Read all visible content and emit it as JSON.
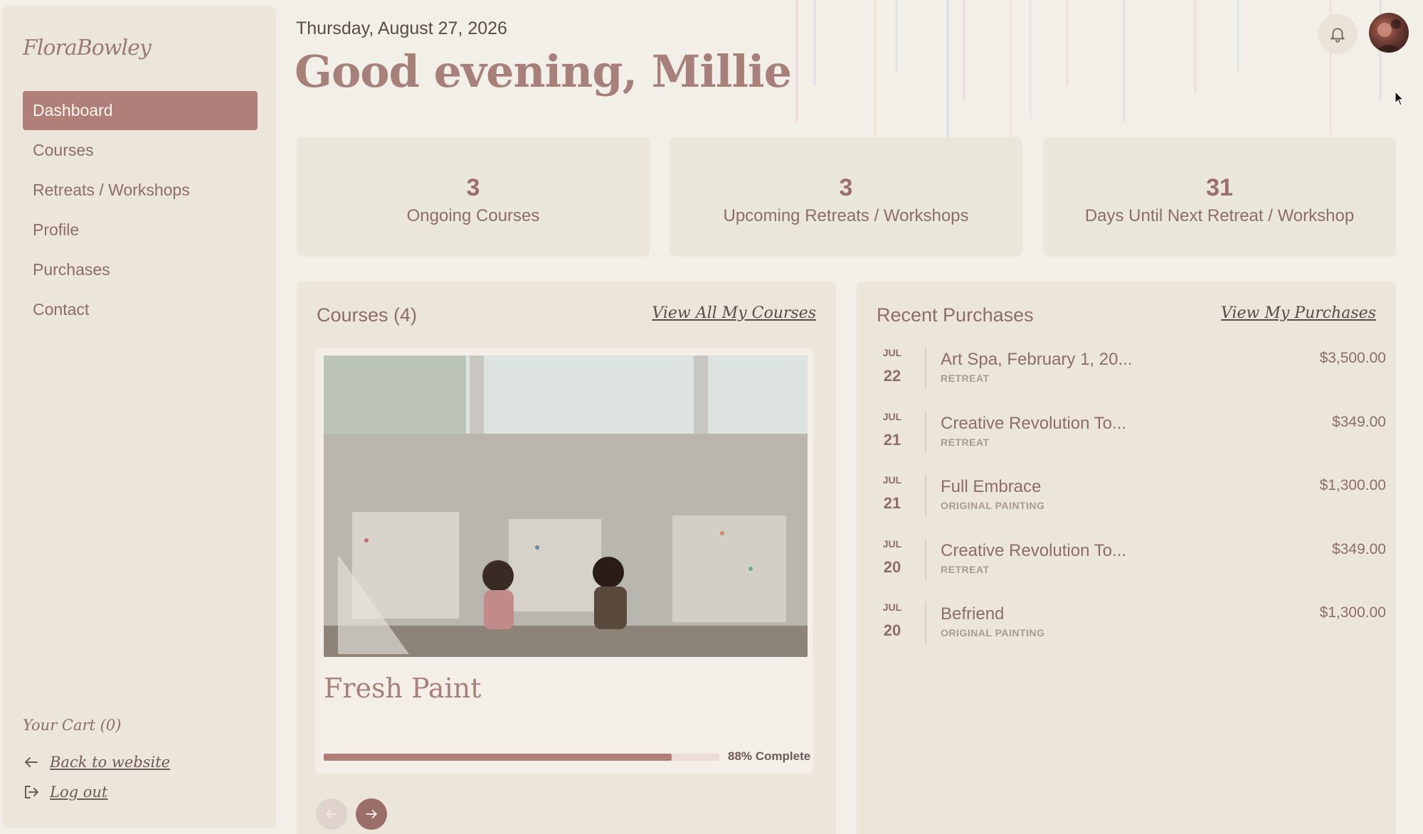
{
  "brand": {
    "logo_text": "FloraBowley"
  },
  "sidebar": {
    "items": [
      {
        "label": "Dashboard",
        "active": true
      },
      {
        "label": "Courses"
      },
      {
        "label": "Retreats / Workshops"
      },
      {
        "label": "Profile"
      },
      {
        "label": "Purchases"
      },
      {
        "label": "Contact"
      }
    ],
    "cart": "Your Cart (0)",
    "back_link": "Back to website",
    "logout_link": "Log out"
  },
  "header": {
    "date": "Thursday, August 27, 2026",
    "greeting": "Good evening, Millie"
  },
  "stats": [
    {
      "value": "3",
      "label": "Ongoing Courses"
    },
    {
      "value": "3",
      "label": "Upcoming Retreats / Workshops"
    },
    {
      "value": "31",
      "label": "Days Until Next Retreat / Workshop"
    }
  ],
  "courses": {
    "title": "Courses (4)",
    "view_all": "View All My Courses",
    "card": {
      "title": "Fresh Paint",
      "progress_percent": 88,
      "progress_label": "88% Complete"
    }
  },
  "purchases": {
    "title": "Recent Purchases",
    "view_all": "View My Purchases",
    "items": [
      {
        "month": "JUL",
        "day": "22",
        "name": "Art Spa, February 1, 20...",
        "type": "RETREAT",
        "price": "$3,500.00"
      },
      {
        "month": "JUL",
        "day": "21",
        "name": "Creative Revolution To...",
        "type": "RETREAT",
        "price": "$349.00"
      },
      {
        "month": "JUL",
        "day": "21",
        "name": "Full Embrace",
        "type": "ORIGINAL PAINTING",
        "price": "$1,300.00"
      },
      {
        "month": "JUL",
        "day": "20",
        "name": "Creative Revolution To...",
        "type": "RETREAT",
        "price": "$349.00"
      },
      {
        "month": "JUL",
        "day": "20",
        "name": "Befriend",
        "type": "ORIGINAL PAINTING",
        "price": "$1,300.00"
      }
    ]
  },
  "colors": {
    "accent": "#b07f7a",
    "background": "#f2efe9",
    "card": "#ebe6da"
  }
}
